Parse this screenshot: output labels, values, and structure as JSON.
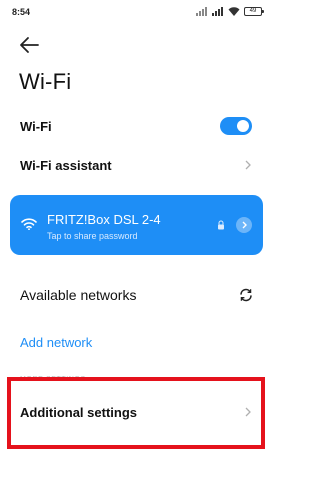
{
  "status_bar": {
    "time": "8:54",
    "battery": "49"
  },
  "header": {
    "title": "Wi-Fi"
  },
  "wifi_toggle": {
    "label": "Wi-Fi",
    "enabled": true,
    "accent": "#1e8ef6"
  },
  "wifi_assistant": {
    "label": "Wi-Fi assistant"
  },
  "connected_network": {
    "name": "FRITZ!Box DSL 2-4",
    "subtitle": "Tap to share password",
    "background": "#1e8ef6"
  },
  "available_networks": {
    "label": "Available networks"
  },
  "add_network": {
    "label": "Add network"
  },
  "more_settings_section": {
    "header": "MORE SETTINGS"
  },
  "additional_settings": {
    "label": "Additional settings"
  },
  "highlight_color": "#e5121c"
}
